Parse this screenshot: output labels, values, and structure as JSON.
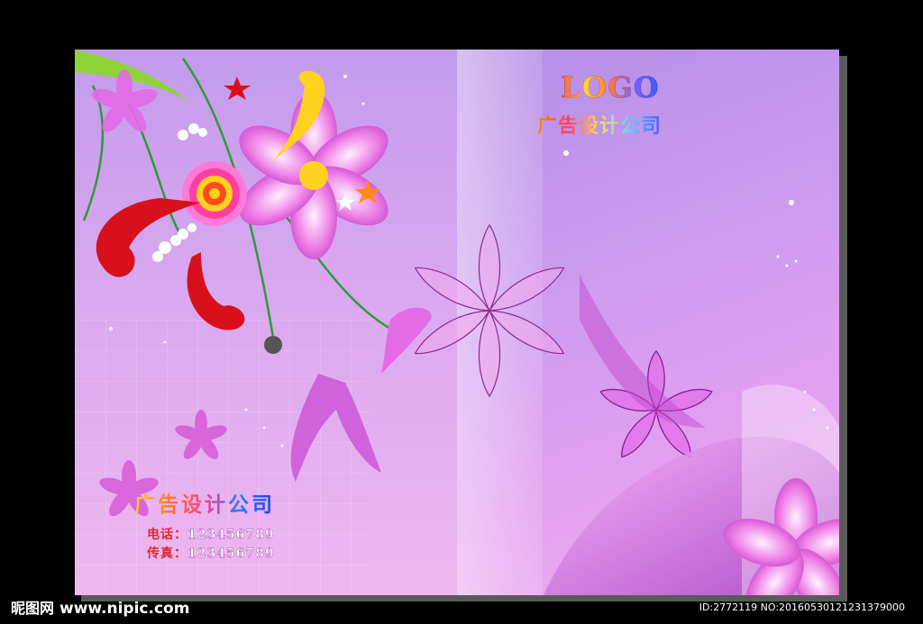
{
  "cover": {
    "logo_text": "LOGO",
    "company_name_top": "广告设计公司",
    "company_name_bottom": "广告设计公司",
    "phone_label": "电话：",
    "phone_value": "123456789",
    "fax_label": "传真：",
    "fax_value": "123456789"
  },
  "watermark": {
    "site_cn": "昵图网",
    "site_url": "www.nipic.com",
    "id_line": "ID:2772119 NO:20160530121231379000"
  },
  "colors": {
    "background": "#000000",
    "cover_top": "#b68ee6",
    "cover_bottom": "#f2b5ee",
    "flower_pink": "#e36be8",
    "accent_red": "#d8101c",
    "accent_yellow": "#ffd21f"
  }
}
